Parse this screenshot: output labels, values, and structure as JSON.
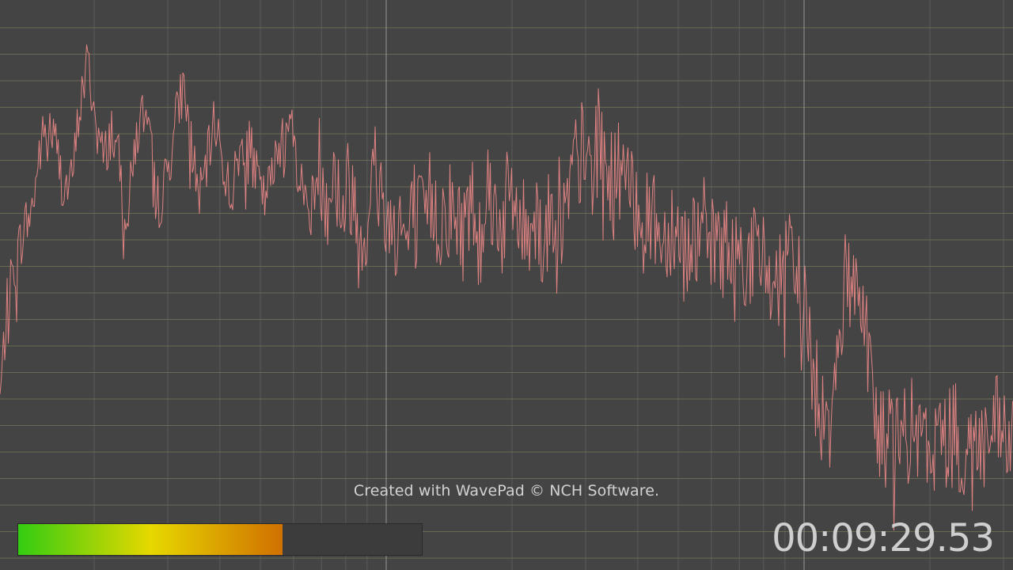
{
  "watermark": "Created with WavePad © NCH Software.",
  "time_display": "00:09:29.53",
  "level_meter": {
    "level": 0.655,
    "gradient": [
      "#33cc11",
      "#e6d800",
      "#d07000"
    ],
    "empty_color": "#3c3c3c"
  },
  "colors": {
    "background": "#444444",
    "h_grid": "#8a8a62",
    "v_grid": "#6a6a6a",
    "v_grid_major": "#9a9a9a",
    "trace": "#f08888"
  },
  "chart_data": {
    "type": "line",
    "title": "",
    "xlabel": "",
    "ylabel": "",
    "x_scale": "log",
    "grid": true,
    "series": [
      {
        "values": [
          0.27,
          0.46,
          0.52,
          0.58,
          0.61,
          0.72,
          0.77,
          0.73,
          0.65,
          0.66,
          0.8,
          0.88,
          0.77,
          0.7,
          0.76,
          0.69,
          0.6,
          0.74,
          0.79,
          0.71,
          0.62,
          0.68,
          0.77,
          0.84,
          0.73,
          0.63,
          0.7,
          0.78,
          0.69,
          0.64,
          0.71,
          0.75,
          0.68,
          0.63,
          0.66,
          0.73,
          0.8,
          0.72,
          0.64,
          0.62,
          0.7,
          0.65,
          0.68,
          0.62,
          0.67,
          0.57,
          0.6,
          0.7,
          0.63,
          0.58,
          0.61,
          0.55,
          0.62,
          0.58,
          0.64,
          0.59,
          0.63,
          0.6,
          0.58,
          0.64,
          0.58,
          0.67,
          0.62,
          0.59,
          0.65,
          0.6,
          0.57,
          0.63,
          0.56,
          0.6,
          0.64,
          0.61,
          0.69,
          0.72,
          0.68,
          0.74,
          0.7,
          0.66,
          0.71,
          0.62,
          0.64,
          0.58,
          0.62,
          0.55,
          0.6,
          0.58,
          0.54,
          0.57,
          0.6,
          0.53,
          0.57,
          0.55,
          0.51,
          0.55,
          0.52,
          0.55,
          0.5,
          0.52,
          0.48,
          0.52,
          0.49,
          0.45,
          0.3,
          0.26,
          0.24,
          0.4,
          0.48,
          0.5,
          0.47,
          0.36,
          0.21,
          0.2,
          0.22,
          0.19,
          0.22,
          0.2,
          0.18,
          0.21,
          0.19,
          0.22,
          0.2,
          0.18,
          0.21,
          0.19,
          0.2,
          0.22,
          0.19,
          0.21
        ]
      }
    ]
  }
}
